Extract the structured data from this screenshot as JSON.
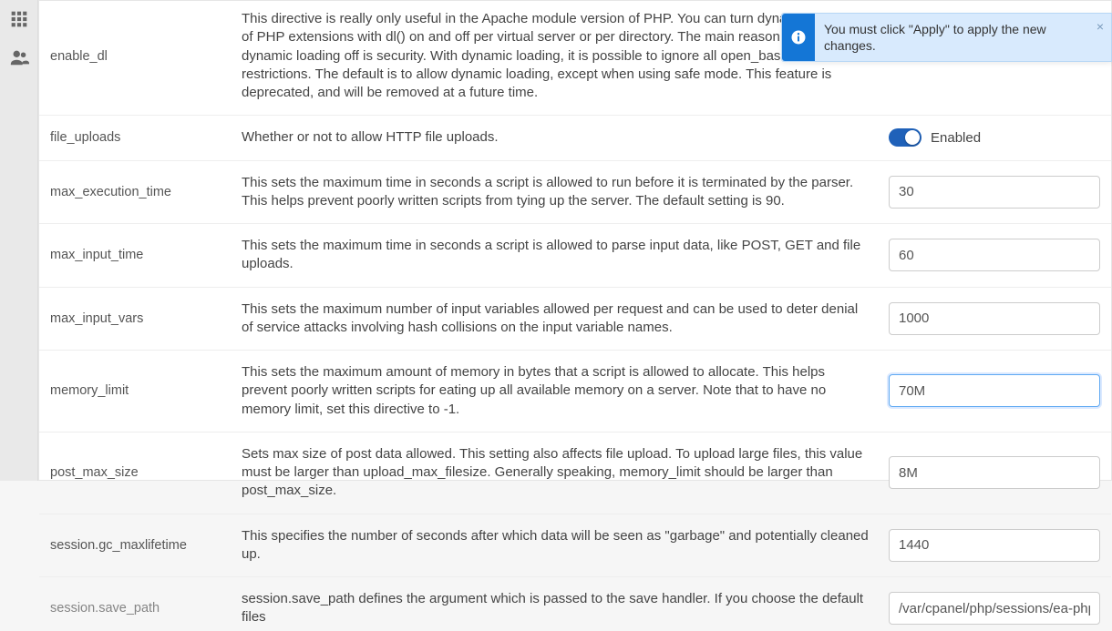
{
  "alert": {
    "message": "You must click \"Apply\" to apply the new changes.",
    "close": "×"
  },
  "toggle_label": "Enabled",
  "rows": [
    {
      "name": "enable_dl",
      "desc": "This directive is really only useful in the Apache module version of PHP. You can turn dynamic loading of PHP extensions with dl() on and off per virtual server or per directory. The main reason for turning dynamic loading off is security. With dynamic loading, it is possible to ignore all open_basedir restrictions. The default is to allow dynamic loading, except when using safe mode. This feature is deprecated, and will be removed at a future time."
    },
    {
      "name": "file_uploads",
      "desc": "Whether or not to allow HTTP file uploads."
    },
    {
      "name": "max_execution_time",
      "desc": "This sets the maximum time in seconds a script is allowed to run before it is terminated by the parser. This helps prevent poorly written scripts from tying up the server. The default setting is 90.",
      "value": "30"
    },
    {
      "name": "max_input_time",
      "desc": "This sets the maximum time in seconds a script is allowed to parse input data, like POST, GET and file uploads.",
      "value": "60"
    },
    {
      "name": "max_input_vars",
      "desc": "This sets the maximum number of input variables allowed per request and can be used to deter denial of service attacks involving hash collisions on the input variable names.",
      "value": "1000"
    },
    {
      "name": "memory_limit",
      "desc": "This sets the maximum amount of memory in bytes that a script is allowed to allocate. This helps prevent poorly written scripts for eating up all available memory on a server. Note that to have no memory limit, set this directive to -1.",
      "value": "70M"
    },
    {
      "name": "post_max_size",
      "desc": "Sets max size of post data allowed. This setting also affects file upload. To upload large files, this value must be larger than upload_max_filesize. Generally speaking, memory_limit should be larger than post_max_size.",
      "value": "8M"
    },
    {
      "name": "session.gc_maxlifetime",
      "desc": "This specifies the number of seconds after which data will be seen as \"garbage\" and potentially cleaned up.",
      "value": "1440"
    },
    {
      "name": "session.save_path",
      "desc": "session.save_path defines the argument which is passed to the save handler. If you choose the default files",
      "value": "/var/cpanel/php/sessions/ea-php"
    }
  ]
}
